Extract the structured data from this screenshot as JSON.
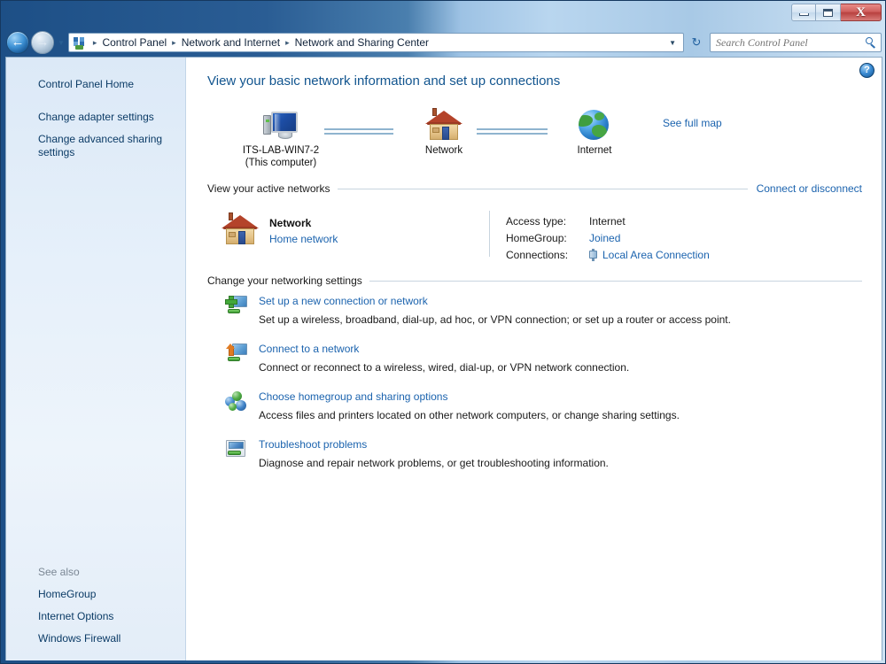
{
  "window": {
    "controls": {
      "minimize": "minimize-button",
      "maximize": "maximize-button",
      "close_glyph": "X"
    }
  },
  "navigation": {
    "back_glyph": "←",
    "forward_glyph": "→",
    "recent_glyph": "▼",
    "refresh_glyph": "↻"
  },
  "address": {
    "crumbs": [
      "Control Panel",
      "Network and Internet",
      "Network and Sharing Center"
    ],
    "separator": "▸",
    "dropdown_glyph": "▼"
  },
  "search": {
    "placeholder": "Search Control Panel",
    "value": ""
  },
  "sidebar": {
    "items": [
      {
        "label": "Control Panel Home"
      },
      {
        "label": "Change adapter settings"
      },
      {
        "label": "Change advanced sharing settings"
      }
    ],
    "see_also_title": "See also",
    "see_also": [
      {
        "label": "HomeGroup"
      },
      {
        "label": "Internet Options"
      },
      {
        "label": "Windows Firewall"
      }
    ]
  },
  "main": {
    "help_glyph": "?",
    "page_title": "View your basic network information and set up connections",
    "map": {
      "computer_name": "ITS-LAB-WIN7-2",
      "computer_sub": "(This computer)",
      "network_label": "Network",
      "internet_label": "Internet",
      "see_full_map": "See full map"
    },
    "active_networks": {
      "heading": "View your active networks",
      "action": "Connect or disconnect",
      "name": "Network",
      "type": "Home network",
      "rows": [
        {
          "key": "Access type:",
          "value": "Internet",
          "is_link": false
        },
        {
          "key": "HomeGroup:",
          "value": "Joined",
          "is_link": true
        },
        {
          "key": "Connections:",
          "value": "Local Area Connection",
          "is_link": true
        }
      ]
    },
    "settings": {
      "heading": "Change your networking settings",
      "items": [
        {
          "link": "Set up a new connection or network",
          "desc": "Set up a wireless, broadband, dial-up, ad hoc, or VPN connection; or set up a router or access point."
        },
        {
          "link": "Connect to a network",
          "desc": "Connect or reconnect to a wireless, wired, dial-up, or VPN network connection."
        },
        {
          "link": "Choose homegroup and sharing options",
          "desc": "Access files and printers located on other network computers, or change sharing settings."
        },
        {
          "link": "Troubleshoot problems",
          "desc": "Diagnose and repair network problems, or get troubleshooting information."
        }
      ]
    }
  },
  "colors": {
    "link": "#1b63ae",
    "title": "#12558f",
    "sidebar_link": "#0b3b66",
    "close_button": "#b8413f"
  }
}
